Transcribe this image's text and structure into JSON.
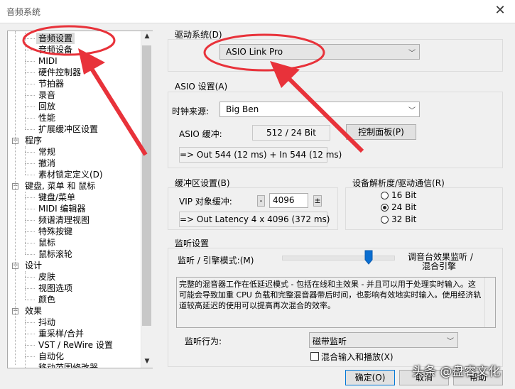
{
  "window": {
    "title": "音频系统"
  },
  "tree": {
    "items": [
      {
        "label": "音频设置",
        "level": 1,
        "selected": true
      },
      {
        "label": "音频设备",
        "level": 1
      },
      {
        "label": "MIDI",
        "level": 1
      },
      {
        "label": "硬件控制器",
        "level": 1
      },
      {
        "label": "节拍器",
        "level": 1
      },
      {
        "label": "录音",
        "level": 1
      },
      {
        "label": "回放",
        "level": 1
      },
      {
        "label": "性能",
        "level": 1
      },
      {
        "label": "扩展缓冲区设置",
        "level": 1
      },
      {
        "label": "程序",
        "level": 0
      },
      {
        "label": "常规",
        "level": 1
      },
      {
        "label": "撤消",
        "level": 1
      },
      {
        "label": "素材锁定定义(D)",
        "level": 1
      },
      {
        "label": "键盘, 菜单 和 鼠标",
        "level": 0
      },
      {
        "label": "键盘/菜单",
        "level": 1
      },
      {
        "label": "MIDI 编辑器",
        "level": 1
      },
      {
        "label": "频谱清理视图",
        "level": 1
      },
      {
        "label": "特殊按键",
        "level": 1
      },
      {
        "label": "鼠标",
        "level": 1
      },
      {
        "label": "鼠标滚轮",
        "level": 1
      },
      {
        "label": "设计",
        "level": 0
      },
      {
        "label": "皮肤",
        "level": 1
      },
      {
        "label": "视图选项",
        "level": 1
      },
      {
        "label": "颜色",
        "level": 1
      },
      {
        "label": "效果",
        "level": 0
      },
      {
        "label": "抖动",
        "level": 1
      },
      {
        "label": "重采样/合并",
        "level": 1
      },
      {
        "label": "VST / ReWire 设置",
        "level": 1
      },
      {
        "label": "自动化",
        "level": 1
      },
      {
        "label": "移动范围修改器",
        "level": 1
      }
    ]
  },
  "driver": {
    "label": "驱动系统(D)",
    "value": "ASIO Link Pro"
  },
  "asio": {
    "label": "ASIO 设置(A)",
    "clock_label": "时钟来源:",
    "clock_value": "Big Ben",
    "buffer_label": "ASIO 缓冲:",
    "buffer_value": "512 / 24 Bit",
    "control_panel": "控制面板(P)",
    "latency": "=> Out 544 (12 ms) + In 544 (12 ms)"
  },
  "buffer": {
    "label": "缓冲区设置(B)",
    "vip_label": "VIP 对象缓冲:",
    "minus": "-",
    "value": "4096",
    "plus": "±",
    "latency": "=> Out Latency 4 x 4096 (372 ms)"
  },
  "resolution": {
    "label": "设备解析度/驱动通信(R)",
    "options": [
      {
        "label": "16 Bit",
        "checked": false
      },
      {
        "label": "24 Bit",
        "checked": true
      },
      {
        "label": "32 Bit",
        "checked": false
      }
    ]
  },
  "monitor": {
    "label": "监听设置",
    "mode_label": "监听 / 引擎模式:(M)",
    "right_label_1": "调音台效果监听 /",
    "right_label_2": "混合引擎",
    "slider_value": 0.78,
    "description": "完整的混音器工作在低延迟模式 - 包括在线和主效果 - 并且可以用于处理实时输入。这可能会导致加重 CPU 负载和完整混音器带后时间，也影响有效地实时输入。使用经济轨道较高延迟的使用可以提高再次混合的效率。",
    "behavior_label": "监听行为:",
    "behavior_value": "磁带监听",
    "mix_input_label": "混合输入和播放(X)"
  },
  "buttons": {
    "ok": "确定(O)",
    "cancel": "取消",
    "help": "帮助"
  },
  "watermark": "头条 @盘睿文化",
  "colors": {
    "annotation": "#e8323a",
    "selection": "#d9d9d9"
  }
}
